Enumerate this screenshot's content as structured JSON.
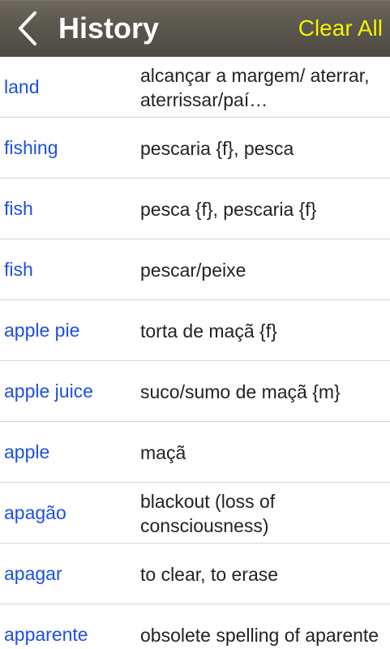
{
  "navbar": {
    "title": "History",
    "clear_label": "Clear All",
    "back_icon": "chevron-left-icon"
  },
  "colors": {
    "term": "#1f4fe0",
    "clear": "#f4f200",
    "definition": "#222222"
  },
  "history": [
    {
      "term": "land",
      "definition": "alcançar a margem/ aterrar, aterrissar/paí…"
    },
    {
      "term": "fishing",
      "definition": "pescaria {f}, pesca"
    },
    {
      "term": "fish",
      "definition": "pesca {f}, pescaria {f}"
    },
    {
      "term": "fish",
      "definition": "pescar/peixe"
    },
    {
      "term": "apple pie",
      "definition": "torta de maçã {f}"
    },
    {
      "term": "apple juice",
      "definition": "suco/sumo de maçã {m}"
    },
    {
      "term": "apple",
      "definition": "maçã"
    },
    {
      "term": "apagão",
      "definition": "blackout (loss of consciousness)"
    },
    {
      "term": "apagar",
      "definition": "to clear, to erase"
    },
    {
      "term": "apparente",
      "definition": "obsolete spelling of aparente"
    }
  ]
}
